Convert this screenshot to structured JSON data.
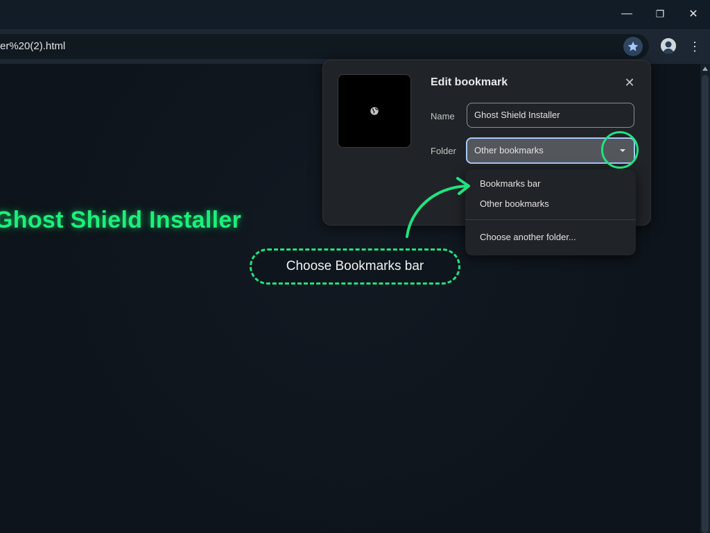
{
  "window": {
    "minimize_glyph": "—",
    "restore_glyph": "❐",
    "close_glyph": "✕"
  },
  "address_bar": {
    "url_text": "er%20(2).html"
  },
  "toolbar": {
    "bookmark_star_icon": "star-icon",
    "menu_glyph": "⋮"
  },
  "page": {
    "heading": "Ghost Shield Installer",
    "heading_color": "#1cf07a"
  },
  "bookmark_dialog": {
    "title": "Edit bookmark",
    "close_glyph": "✕",
    "name_label": "Name",
    "name_value": "Ghost Shield Installer",
    "folder_label": "Folder",
    "folder_value": "Other bookmarks",
    "folder_options": [
      "Bookmarks bar",
      "Other bookmarks"
    ],
    "choose_another": "Choose another folder..."
  },
  "annotation": {
    "callout_text": "Choose Bookmarks bar",
    "accent_color": "#1ee47f"
  }
}
